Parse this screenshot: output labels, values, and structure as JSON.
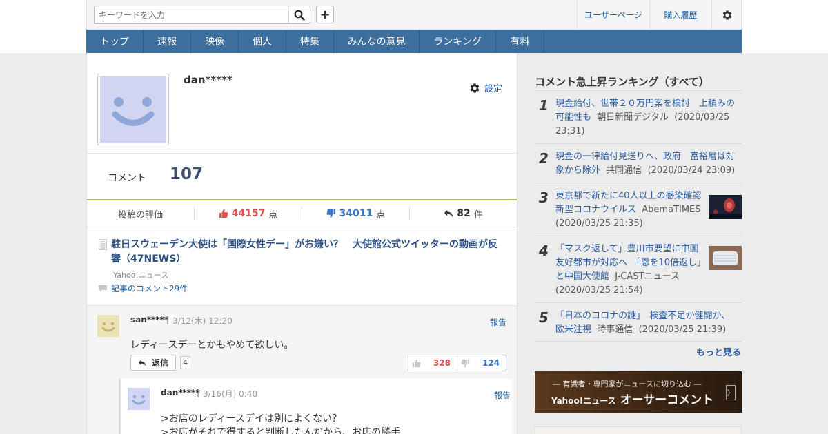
{
  "header": {
    "search_placeholder": "キーワードを入力",
    "user_page": "ユーザーページ",
    "purchase_history": "購入履歴"
  },
  "nav": [
    "トップ",
    "速報",
    "映像",
    "個人",
    "特集",
    "みんなの意見",
    "ランキング",
    "有料"
  ],
  "profile": {
    "username": "dan*****",
    "settings_label": "設定",
    "comment_label": "コメント",
    "comment_count": "107"
  },
  "evaluation": {
    "label": "投稿の評価",
    "likes": "44157",
    "likes_unit": "点",
    "dislikes": "34011",
    "dislikes_unit": "点",
    "replies": "82",
    "replies_unit": "件"
  },
  "article": {
    "title": "駐日スウェーデン大使は「国際女性デー」がお嫌い？　大使館公式ツイッターの動画が反響（47NEWS）",
    "source": "Yahoo!ニュース",
    "comments_link": "記事のコメント29件"
  },
  "comment": {
    "user": "san*****",
    "sep": "|",
    "date": "3/12(木) 12:20",
    "report": "報告",
    "body": "レディースデーとかもやめて欲しい。",
    "reply_label": "返信",
    "reply_count": "4",
    "likes": "328",
    "dislikes": "124"
  },
  "reply": {
    "user": "dan*****",
    "sep": "|",
    "date": "3/16(月) 0:40",
    "report": "報告",
    "line1": ">お店のレディースデイは別によくない？",
    "line2": ">お店がそれで得すると判断したんだから、お店の勝手"
  },
  "sidebar": {
    "title": "コメント急上昇ランキング（すべて）",
    "items": [
      {
        "num": "1",
        "title": "現金給付、世帯２０万円案を検討　上積みの可能性も",
        "source": "朝日新聞デジタル",
        "date": "(2020/03/25 23:31)"
      },
      {
        "num": "2",
        "title": "現金の一律給付見送りへ、政府　富裕層は対象から除外",
        "source": "共同通信",
        "date": "(2020/03/24 23:09)"
      },
      {
        "num": "3",
        "title": "東京都で新たに40人以上の感染確認 新型コロナウイルス",
        "source": "AbemaTIMES",
        "date": "(2020/03/25 21:35)"
      },
      {
        "num": "4",
        "title": "「マスク返して」豊川市要望に中国友好都市が対応へ　「恩を10倍返し」と中国大使館",
        "source": "J-CASTニュース",
        "date": "(2020/03/25 21:54)"
      },
      {
        "num": "5",
        "title": "「日本のコロナの謎」　検査不足か健闘か、欧米注視",
        "source": "時事通信",
        "date": "(2020/03/25 21:39)"
      }
    ],
    "more": "もっと見る",
    "banner_top": "― 有識者・専門家がニュースに切り込む ―",
    "banner_yahoo": "Yahoo!ニュース",
    "banner_main": "オーサーコメント",
    "banner_arrow": "〉"
  },
  "colors": {
    "nav_bg": "#3c6e9e",
    "link": "#1f5fa6",
    "like_red": "#e05050",
    "dislike_blue": "#3d73c4",
    "accent_green": "#a8c74a"
  }
}
